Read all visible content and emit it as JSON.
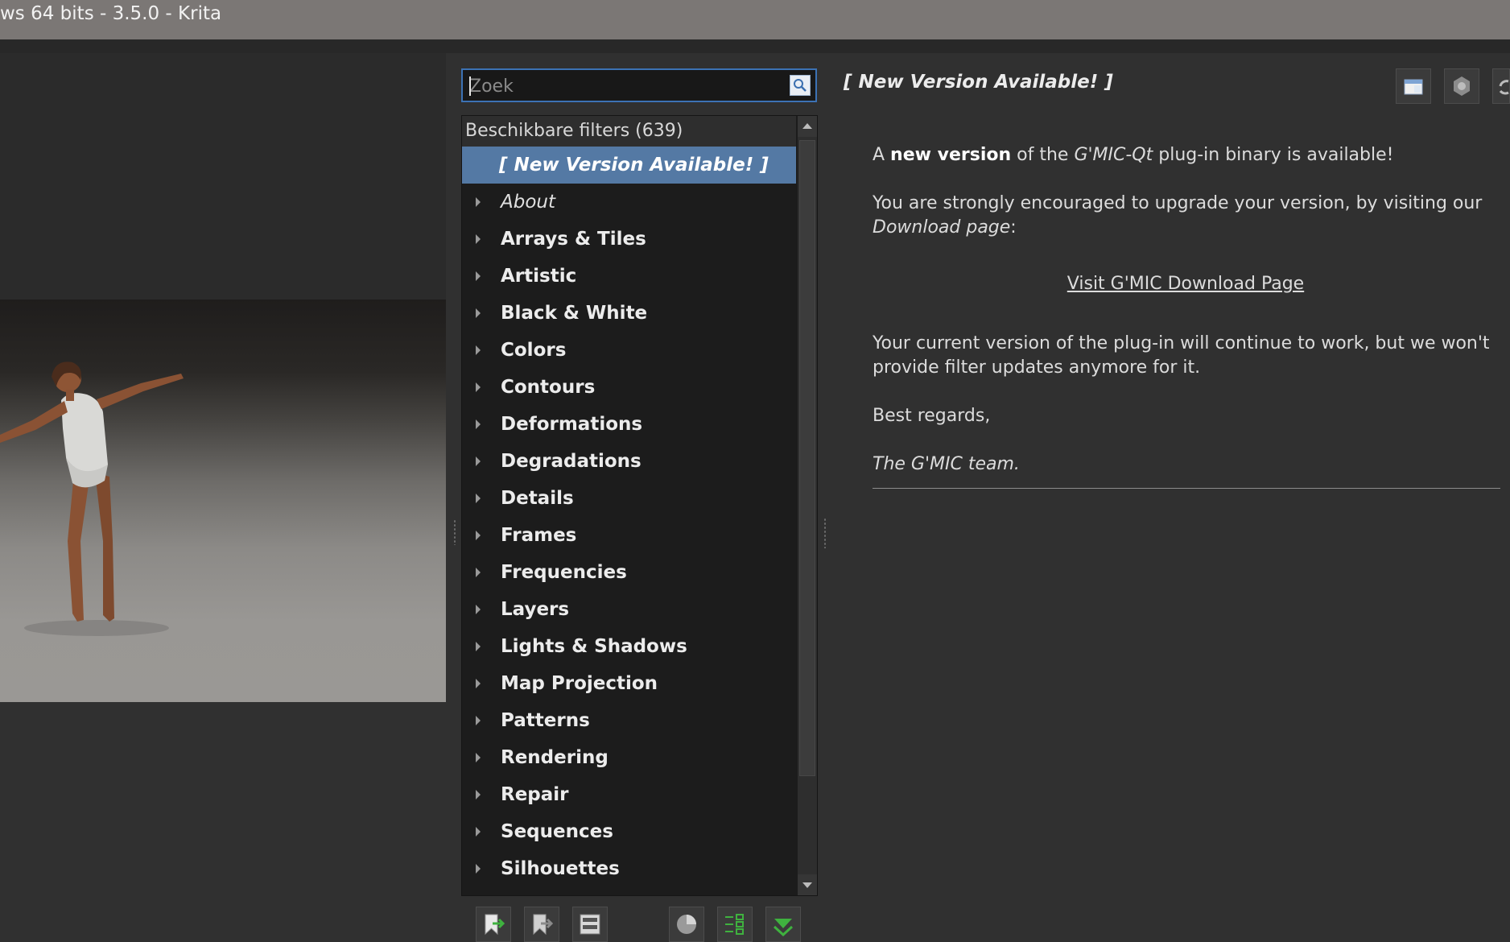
{
  "window": {
    "title": "ws 64 bits - 3.5.0 - Krita"
  },
  "search": {
    "placeholder": "Zoek"
  },
  "filters": {
    "header": "Beschikbare filters (639)",
    "items": [
      {
        "label": "[ New Version Available! ]",
        "selected": true
      },
      {
        "label": "About"
      },
      {
        "label": "Arrays & Tiles"
      },
      {
        "label": "Artistic"
      },
      {
        "label": "Black & White"
      },
      {
        "label": "Colors"
      },
      {
        "label": "Contours"
      },
      {
        "label": "Deformations"
      },
      {
        "label": "Degradations"
      },
      {
        "label": "Details"
      },
      {
        "label": "Frames"
      },
      {
        "label": "Frequencies"
      },
      {
        "label": "Layers"
      },
      {
        "label": "Lights & Shadows"
      },
      {
        "label": "Map Projection"
      },
      {
        "label": "Patterns"
      },
      {
        "label": "Rendering"
      },
      {
        "label": "Repair"
      },
      {
        "label": "Sequences"
      },
      {
        "label": "Silhouettes"
      }
    ]
  },
  "panel": {
    "title": "[ New Version Available! ]",
    "line1_a": "A ",
    "line1_b": "new version",
    "line1_c": " of the ",
    "line1_d": "G'MIC-Qt",
    "line1_e": " plug-in binary is available!",
    "line2_a": "You are strongly encouraged to upgrade your version, by visiting our ",
    "line2_b": "Download page",
    "line2_c": ":",
    "link": "Visit G'MIC Download Page",
    "line3": "Your current version of the plug-in will continue to work, but we won't provide filter updates anymore for it.",
    "line4": "Best regards,",
    "line5": "The G'MIC team."
  },
  "icons": {
    "top": [
      "window-icon",
      "settings-gear-icon",
      "refresh-icon"
    ],
    "bottom": [
      "add-favorite-icon",
      "remove-favorite-icon",
      "rename-icon",
      "visibility-icon",
      "select-all-icon",
      "download-icon"
    ]
  },
  "colors": {
    "selection": "#5479a4",
    "focus": "#3c72b4",
    "accent_green": "#3fb23f"
  }
}
